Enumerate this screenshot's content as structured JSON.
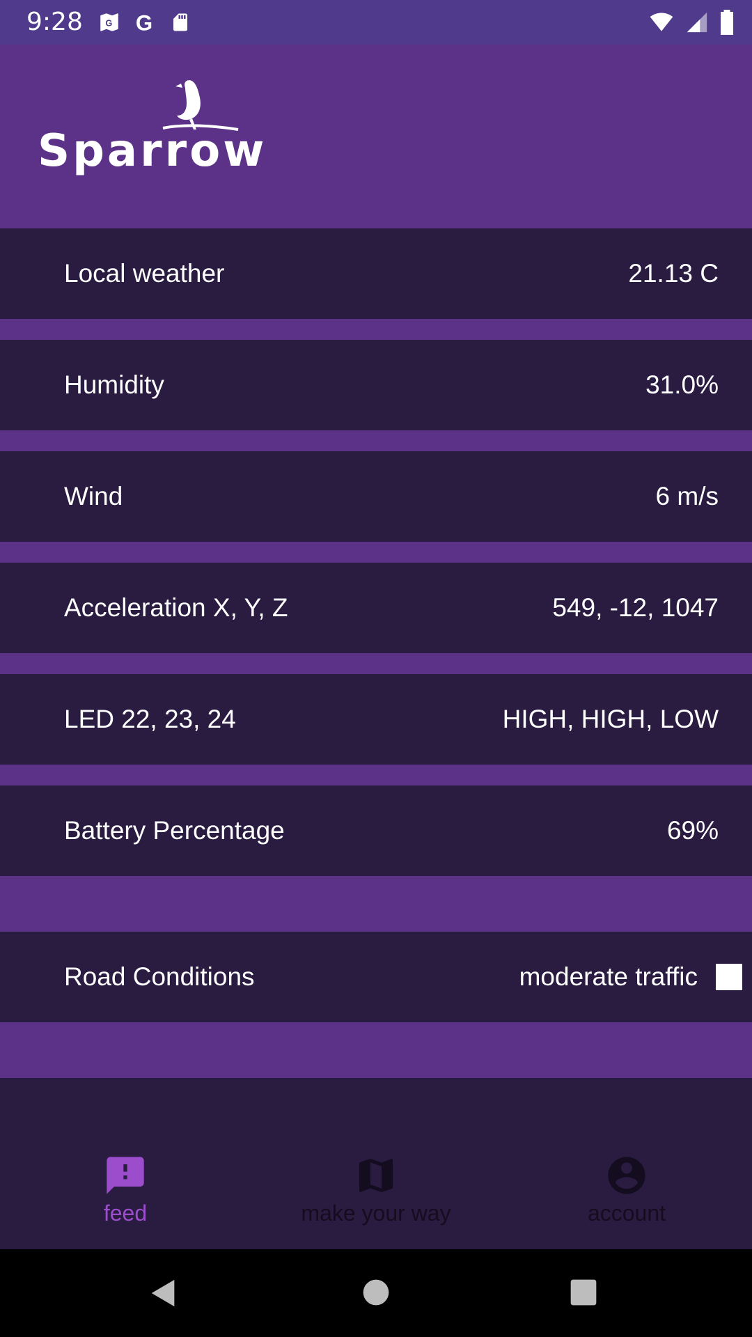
{
  "status_bar": {
    "time": "9:28",
    "left_icons": [
      "maps-icon",
      "google-icon",
      "sd-card-icon"
    ],
    "right_icons": [
      "wifi-icon",
      "signal-icon",
      "battery-icon"
    ]
  },
  "app": {
    "logo_text": "Sparrow",
    "brand_color": "#5b3287",
    "row_color": "#2a1b41"
  },
  "rows": [
    {
      "label": "Local weather",
      "value": "21.13 C"
    },
    {
      "label": "Humidity",
      "value": "31.0%"
    },
    {
      "label": "Wind",
      "value": "6 m/s"
    },
    {
      "label": "Acceleration X, Y, Z",
      "value": "549, -12, 1047"
    },
    {
      "label": "LED 22, 23, 24",
      "value": "HIGH, HIGH, LOW"
    },
    {
      "label": "Battery Percentage",
      "value": "69%"
    },
    {
      "label": "Road Conditions",
      "value": "moderate traffic",
      "checked": false
    }
  ],
  "bottom_nav": {
    "items": [
      {
        "label": "feed",
        "icon": "feedback-icon",
        "active": true
      },
      {
        "label": "make your way",
        "icon": "map-icon",
        "active": false
      },
      {
        "label": "account",
        "icon": "account-circle-icon",
        "active": false
      }
    ],
    "active_color": "#9b4dcc"
  },
  "system_nav": [
    "back-icon",
    "home-icon",
    "recents-icon"
  ]
}
